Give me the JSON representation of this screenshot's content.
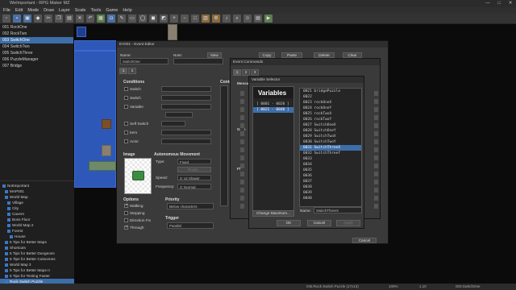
{
  "window": {
    "title": "WeImportant - RPG Maker MZ",
    "min": "—",
    "max": "□",
    "close": "✕"
  },
  "menu": [
    "File",
    "Edit",
    "Mode",
    "Draw",
    "Layer",
    "Scale",
    "Tools",
    "Game",
    "Help"
  ],
  "switch_list": [
    {
      "label": "001 RockOne",
      "selected": false
    },
    {
      "label": "002 RockTwo",
      "selected": false
    },
    {
      "label": "003 SwitchOne",
      "selected": true
    },
    {
      "label": "004 SwitchTwo",
      "selected": false
    },
    {
      "label": "005 SwitchThree",
      "selected": false
    },
    {
      "label": "006 PuzzleManager",
      "selected": false
    },
    {
      "label": "007 Bridge",
      "selected": false
    }
  ],
  "tree": [
    {
      "label": "NotImportant",
      "indent": 1,
      "selected": false
    },
    {
      "label": "MAP001",
      "indent": 2,
      "selected": false
    },
    {
      "label": "World Map",
      "indent": 2,
      "selected": false
    },
    {
      "label": "Village",
      "indent": 3,
      "selected": false
    },
    {
      "label": "City",
      "indent": 3,
      "selected": false
    },
    {
      "label": "Cavern",
      "indent": 3,
      "selected": false
    },
    {
      "label": "Boss Floor",
      "indent": 3,
      "selected": false
    },
    {
      "label": "World Map 2",
      "indent": 3,
      "selected": false
    },
    {
      "label": "Forest",
      "indent": 3,
      "selected": false
    },
    {
      "label": "House",
      "indent": 4,
      "selected": false
    },
    {
      "label": "5 Tips for Better Maps",
      "indent": 2,
      "selected": false
    },
    {
      "label": "Shortcuts",
      "indent": 2,
      "selected": false
    },
    {
      "label": "5 Tips for Better Dungeons",
      "indent": 2,
      "selected": false
    },
    {
      "label": "5 Tips for Better Cutscenes",
      "indent": 2,
      "selected": false
    },
    {
      "label": "World Map 3",
      "indent": 2,
      "selected": false
    },
    {
      "label": "5 Tips for Better Maps II",
      "indent": 2,
      "selected": false
    },
    {
      "label": "5 Tips for Testing Faster",
      "indent": 2,
      "selected": false
    },
    {
      "label": "Rock Switch Puzzle",
      "indent": 2,
      "selected": true
    }
  ],
  "event_editor": {
    "title": "EV001 - Event Editor",
    "name_label": "Name:",
    "name_value": "SwitchOne",
    "note_label": "Note:",
    "page_tabs": [
      "1",
      "2"
    ],
    "conditions_label": "Conditions",
    "cond": [
      "Switch",
      "Switch",
      "Variable",
      "Self Switch",
      "Item",
      "Actor"
    ],
    "contents_label": "Contents",
    "image_label": "Image",
    "auto_move_label": "Autonomous Movement",
    "type_label": "Type:",
    "type_value": "Fixed",
    "route_btn": "Route...",
    "speed_label": "Speed:",
    "speed_value": "3: x2 Slower",
    "freq_label": "Frequency:",
    "freq_value": "3: Normal",
    "options_label": "Options",
    "options": [
      {
        "label": "Walking",
        "checked": true
      },
      {
        "label": "Stepping",
        "checked": false
      },
      {
        "label": "Direction Fix",
        "checked": false
      },
      {
        "label": "Through",
        "checked": true
      }
    ],
    "priority_label": "Priority",
    "priority_value": "Below characters",
    "trigger_label": "Trigger",
    "trigger_value": "Parallel",
    "cancel": "Cancel",
    "top_buttons": [
      "New",
      "Copy",
      "Paste",
      "Delete",
      "Clear"
    ]
  },
  "event_commands": {
    "title": "Event Commands",
    "tabs": [
      "1",
      "2",
      "3"
    ],
    "side": [
      "Messa",
      "Gam",
      "Flo"
    ]
  },
  "variable_selector": {
    "title": "Variable Selector",
    "heading": "Variables",
    "groups": [
      {
        "label": "[ 0001 - 0020 ]",
        "selected": false
      },
      {
        "label": "[ 0021 - 0040 ]",
        "selected": true
      }
    ],
    "items": [
      {
        "label": "0021 bridgePuzzle",
        "selected": false
      },
      {
        "label": "0022",
        "selected": false
      },
      {
        "label": "0023 rockOneX",
        "selected": false
      },
      {
        "label": "0024 rockOneY",
        "selected": false
      },
      {
        "label": "0025 rockTwoX",
        "selected": false
      },
      {
        "label": "0026 rockTwoY",
        "selected": false
      },
      {
        "label": "0027 SwitchOneX",
        "selected": false
      },
      {
        "label": "0028 SwitchOneY",
        "selected": false
      },
      {
        "label": "0029 SwitchTwoX",
        "selected": false
      },
      {
        "label": "0030 SwitchTwoY",
        "selected": false
      },
      {
        "label": "0031 SwitchThreeX",
        "selected": true
      },
      {
        "label": "0032 SwitchThreeY",
        "selected": false
      },
      {
        "label": "0033",
        "selected": false
      },
      {
        "label": "0034",
        "selected": false
      },
      {
        "label": "0035",
        "selected": false
      },
      {
        "label": "0036",
        "selected": false
      },
      {
        "label": "0037",
        "selected": false
      },
      {
        "label": "0038",
        "selected": false
      },
      {
        "label": "0039",
        "selected": false
      },
      {
        "label": "0040",
        "selected": false
      }
    ],
    "change_max": "Change Maximum...",
    "name_label": "Name:",
    "name_value": "SwitchThreeX",
    "ok": "OK",
    "cancel": "Cancel",
    "apply": "Apply"
  },
  "status": {
    "map": "045:Rock Switch Puzzle (17x13)",
    "zoom": "100%",
    "coords": "1,10",
    "event": "003:SwitchOne"
  },
  "colors": {
    "selection": "#3d6ea8",
    "tile": "#2e58b8"
  }
}
